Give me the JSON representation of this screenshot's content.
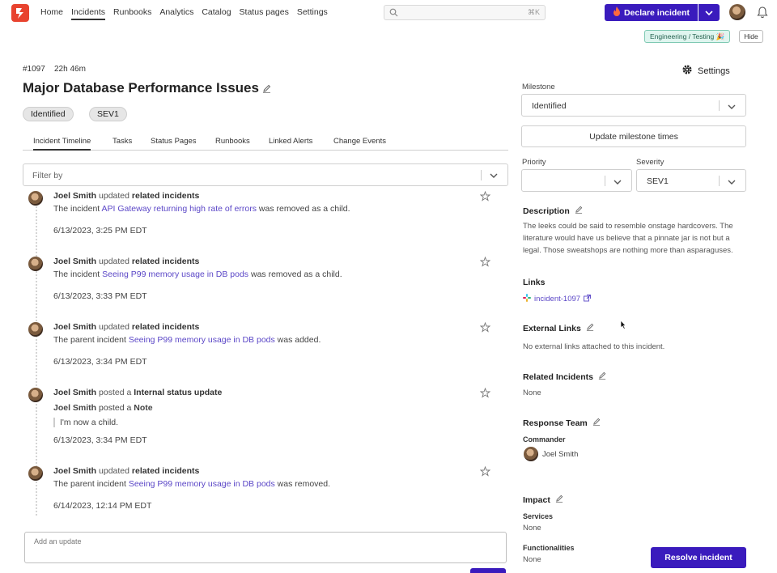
{
  "nav": {
    "items": [
      "Home",
      "Incidents",
      "Runbooks",
      "Analytics",
      "Catalog",
      "Status pages",
      "Settings"
    ],
    "search_shortcut": "⌘K",
    "declare_label": "Declare incident"
  },
  "env_badge": "Engineering / Testing 🎉",
  "hide_label": "Hide",
  "incident": {
    "id": "#1097",
    "duration": "22h 46m",
    "title": "Major Database Performance Issues",
    "milestone_pill": "Identified",
    "severity_pill": "SEV1"
  },
  "tabs": [
    "Incident Timeline",
    "Tasks",
    "Status Pages",
    "Runbooks",
    "Linked Alerts",
    "Change Events"
  ],
  "filter_placeholder": "Filter by",
  "timeline": [
    {
      "author": "Joel Smith",
      "action": "updated",
      "object": "related incidents",
      "body_prefix": "The incident ",
      "link": "API Gateway returning high rate of errors",
      "body_suffix": " was removed as a child.",
      "time": "6/13/2023, 3:25 PM EDT"
    },
    {
      "author": "Joel Smith",
      "action": "updated",
      "object": "related incidents",
      "body_prefix": "The incident ",
      "link": "Seeing P99 memory usage in DB pods",
      "body_suffix": " was removed as a child.",
      "time": "6/13/2023, 3:33 PM EDT"
    },
    {
      "author": "Joel Smith",
      "action": "updated",
      "object": "related incidents",
      "body_prefix": "The parent incident ",
      "link": "Seeing P99 memory usage in DB pods",
      "body_suffix": " was added.",
      "time": "6/13/2023, 3:34 PM EDT"
    },
    {
      "author": "Joel Smith",
      "action": "posted a",
      "object": "Internal status update",
      "sub_author": "Joel Smith",
      "sub_action": "posted a",
      "sub_object": "Note",
      "quote": "I'm now a child.",
      "time": "6/13/2023, 3:34 PM EDT"
    },
    {
      "author": "Joel Smith",
      "action": "updated",
      "object": "related incidents",
      "body_prefix": "The parent incident ",
      "link": "Seeing P99 memory usage in DB pods",
      "body_suffix": " was removed.",
      "time": "6/14/2023, 12:14 PM EDT"
    }
  ],
  "update_placeholder": "Add an update",
  "sidebar": {
    "settings_label": "Settings",
    "milestone_label": "Milestone",
    "milestone_value": "Identified",
    "update_times_label": "Update milestone times",
    "priority_label": "Priority",
    "priority_value": "",
    "severity_label": "Severity",
    "severity_value": "SEV1",
    "description_title": "Description",
    "description_text": "The leeks could be said to resemble onstage hardcovers. The literature would have us believe that a pinnate jar is not but a legal. Those sweatshops are nothing more than asparaguses.",
    "links_title": "Links",
    "slack_link": "incident-1097",
    "external_links_title": "External Links",
    "external_links_empty": "No external links attached to this incident.",
    "related_title": "Related Incidents",
    "related_value": "None",
    "response_team_title": "Response Team",
    "commander_label": "Commander",
    "commander_name": "Joel Smith",
    "impact_title": "Impact",
    "services_label": "Services",
    "services_value": "None",
    "functionalities_label": "Functionalities",
    "functionalities_value": "None",
    "resolve_label": "Resolve incident"
  },
  "colors": {
    "brand": "#3a1bbd",
    "link": "#5b47c7",
    "logo": "#e8432f"
  }
}
